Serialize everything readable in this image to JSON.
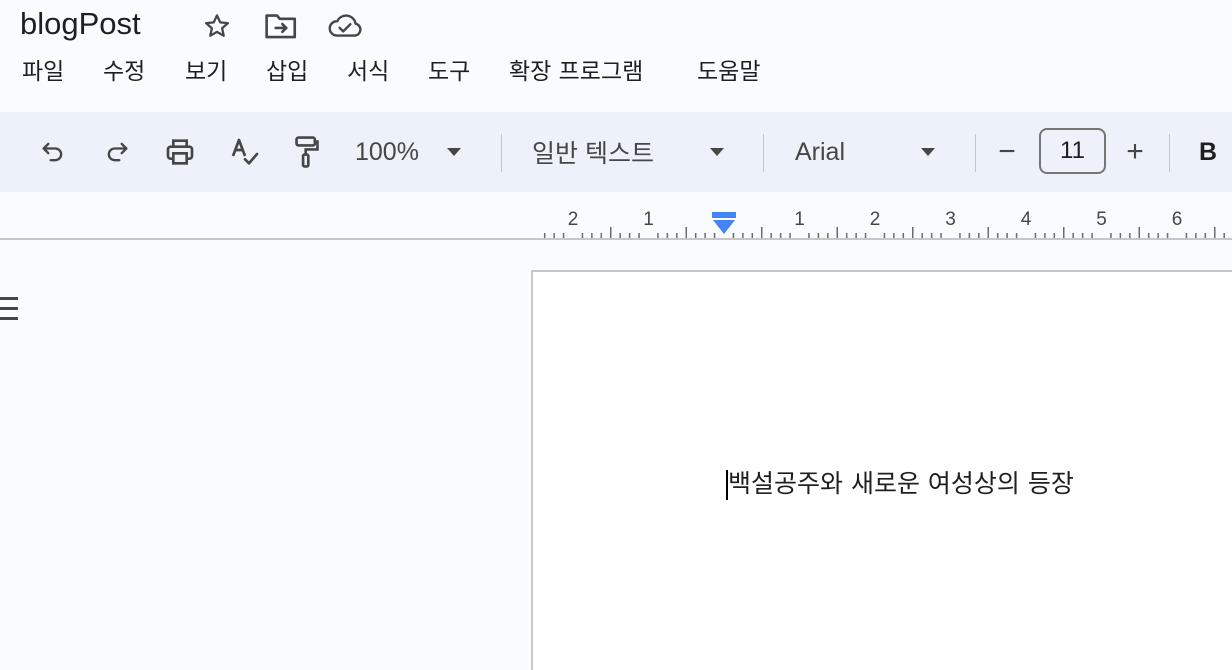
{
  "document": {
    "title": "blogPost",
    "body_text": "백설공주와 새로운 여성상의 등장"
  },
  "title_icons": [
    "star-icon",
    "move-to-folder-icon",
    "cloud-saved-icon"
  ],
  "menu": {
    "items": [
      {
        "label": "파일"
      },
      {
        "label": "수정"
      },
      {
        "label": "보기"
      },
      {
        "label": "삽입"
      },
      {
        "label": "서식"
      },
      {
        "label": "도구"
      },
      {
        "label": "확장 프로그램"
      },
      {
        "label": "도움말"
      }
    ]
  },
  "toolbar": {
    "zoom": "100%",
    "style": "일반 텍스트",
    "font": "Arial",
    "font_size": "11",
    "decrease": "−",
    "increase": "+",
    "bold": "B",
    "icons": [
      "undo-icon",
      "redo-icon",
      "print-icon",
      "spellcheck-icon",
      "paint-format-icon"
    ]
  },
  "ruler": {
    "left_labels": [
      "2",
      "1"
    ],
    "right_labels": [
      "1",
      "2",
      "3",
      "4",
      "5",
      "6"
    ],
    "indent_marker_color": "#4285f4"
  },
  "colors": {
    "background": "#f9fbfd",
    "toolbar_bg": "#edf2fa",
    "page": "#ffffff"
  }
}
